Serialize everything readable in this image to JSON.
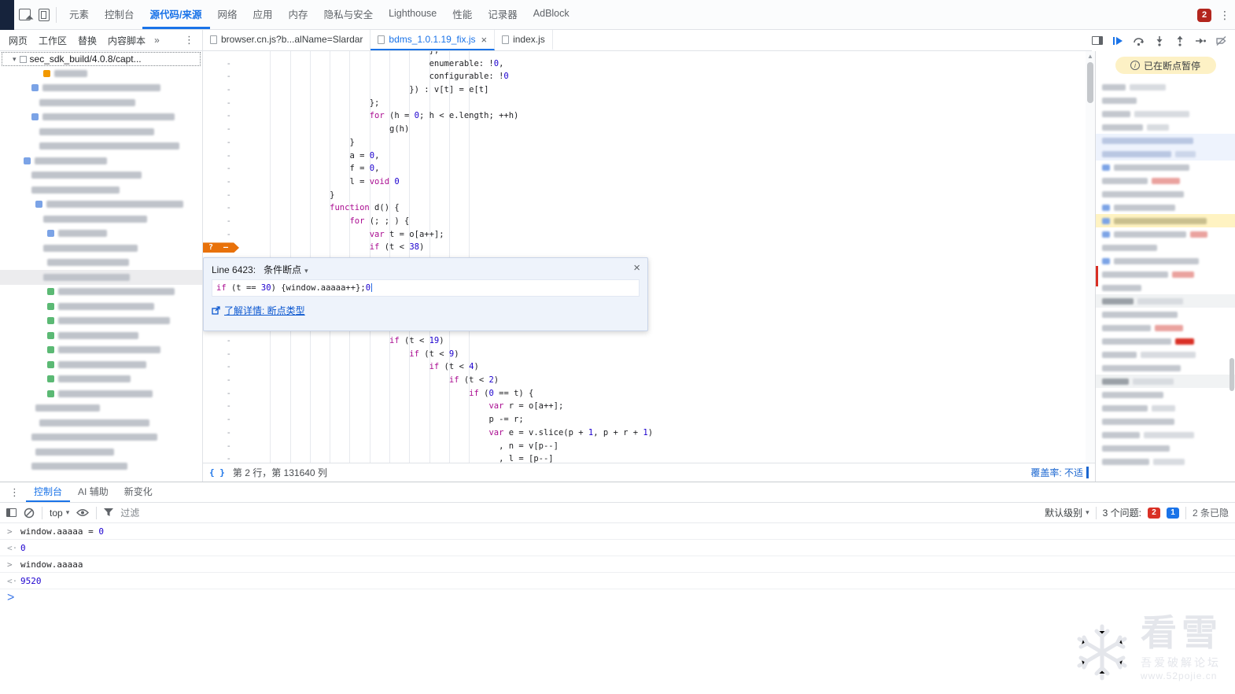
{
  "topbar": {
    "tabs": [
      {
        "label": "元素",
        "active": false
      },
      {
        "label": "控制台",
        "active": false
      },
      {
        "label": "源代码/来源",
        "active": true
      },
      {
        "label": "网络",
        "active": false
      },
      {
        "label": "应用",
        "active": false
      },
      {
        "label": "内存",
        "active": false
      },
      {
        "label": "隐私与安全",
        "active": false
      },
      {
        "label": "Lighthouse",
        "active": false
      },
      {
        "label": "性能",
        "active": false
      },
      {
        "label": "记录器",
        "active": false
      },
      {
        "label": "AdBlock",
        "active": false
      }
    ],
    "error_count": "2"
  },
  "sources": {
    "sidebar_tabs": [
      "网页",
      "工作区",
      "替换",
      "内容脚本"
    ],
    "overflow_label": "»",
    "tree_root": "sec_sdk_build/4.0.8/capt...",
    "file_tabs": [
      {
        "label": "browser.cn.js?b...alName=Slardar",
        "active": false,
        "closable": false
      },
      {
        "label": "bdms_1.0.1.19_fix.js",
        "active": true,
        "closable": true
      },
      {
        "label": "index.js",
        "active": false,
        "closable": false
      }
    ],
    "paused_banner": "已在断点暂停"
  },
  "editor": {
    "gutter_char": "-",
    "bp_marker": "?",
    "dialog_after_index": 15,
    "lines": [
      {
        "ind": 36,
        "tk": [
          [
            "p",
            "},"
          ]
        ]
      },
      {
        "ind": 36,
        "tk": [
          [
            "p",
            "enumerable: !"
          ],
          [
            "n",
            "0"
          ],
          [
            "p",
            ","
          ]
        ]
      },
      {
        "ind": 36,
        "tk": [
          [
            "p",
            "configurable: !"
          ],
          [
            "n",
            "0"
          ]
        ]
      },
      {
        "ind": 32,
        "tk": [
          [
            "p",
            "}) : v[t] = e[t]"
          ]
        ]
      },
      {
        "ind": 24,
        "tk": [
          [
            "p",
            "};"
          ]
        ]
      },
      {
        "ind": 24,
        "tk": [
          [
            "k",
            "for"
          ],
          [
            "p",
            " (h = "
          ],
          [
            "n",
            "0"
          ],
          [
            "p",
            "; h < e.length; ++h)"
          ]
        ]
      },
      {
        "ind": 28,
        "tk": [
          [
            "p",
            "g(h)"
          ]
        ]
      },
      {
        "ind": 20,
        "tk": [
          [
            "p",
            "}"
          ]
        ]
      },
      {
        "ind": 20,
        "tk": [
          [
            "p",
            "a = "
          ],
          [
            "n",
            "0"
          ],
          [
            "p",
            ","
          ]
        ]
      },
      {
        "ind": 20,
        "tk": [
          [
            "p",
            "f = "
          ],
          [
            "n",
            "0"
          ],
          [
            "p",
            ","
          ]
        ]
      },
      {
        "ind": 20,
        "tk": [
          [
            "p",
            "l = "
          ],
          [
            "k",
            "void"
          ],
          [
            "p",
            " "
          ],
          [
            "n",
            "0"
          ]
        ]
      },
      {
        "ind": 16,
        "tk": [
          [
            "p",
            "}"
          ]
        ]
      },
      {
        "ind": 16,
        "tk": [
          [
            "k",
            "function"
          ],
          [
            "p",
            " d() {"
          ]
        ]
      },
      {
        "ind": 20,
        "tk": [
          [
            "k",
            "for"
          ],
          [
            "p",
            " (; ; ) {"
          ]
        ]
      },
      {
        "ind": 24,
        "tk": [
          [
            "k",
            "var"
          ],
          [
            "p",
            " t = o[a++];"
          ]
        ]
      },
      {
        "ind": 24,
        "tk": [
          [
            "k",
            "if"
          ],
          [
            "p",
            " (t < "
          ],
          [
            "n",
            "38"
          ],
          [
            "p",
            ")"
          ]
        ],
        "bp": true
      },
      {
        "ind": 28,
        "tk": [
          [
            "k",
            "if"
          ],
          [
            "p",
            " (t < "
          ],
          [
            "n",
            "19"
          ],
          [
            "p",
            ")"
          ]
        ]
      },
      {
        "ind": 32,
        "tk": [
          [
            "k",
            "if"
          ],
          [
            "p",
            " (t < "
          ],
          [
            "n",
            "9"
          ],
          [
            "p",
            ")"
          ]
        ]
      },
      {
        "ind": 36,
        "tk": [
          [
            "k",
            "if"
          ],
          [
            "p",
            " (t < "
          ],
          [
            "n",
            "4"
          ],
          [
            "p",
            ")"
          ]
        ]
      },
      {
        "ind": 40,
        "tk": [
          [
            "k",
            "if"
          ],
          [
            "p",
            " (t < "
          ],
          [
            "n",
            "2"
          ],
          [
            "p",
            ")"
          ]
        ]
      },
      {
        "ind": 44,
        "tk": [
          [
            "k",
            "if"
          ],
          [
            "p",
            " ("
          ],
          [
            "n",
            "0"
          ],
          [
            "p",
            " == t) {"
          ]
        ]
      },
      {
        "ind": 48,
        "tk": [
          [
            "k",
            "var"
          ],
          [
            "p",
            " r = o[a++];"
          ]
        ]
      },
      {
        "ind": 48,
        "tk": [
          [
            "p",
            "p -= r;"
          ]
        ]
      },
      {
        "ind": 48,
        "tk": [
          [
            "k",
            "var"
          ],
          [
            "p",
            " e = v.slice(p + "
          ],
          [
            "n",
            "1"
          ],
          [
            "p",
            ", p + r + "
          ],
          [
            "n",
            "1"
          ],
          [
            "p",
            ")"
          ]
        ]
      },
      {
        "ind": 50,
        "tk": [
          [
            "p",
            ", n = v[p--]"
          ]
        ]
      },
      {
        "ind": 50,
        "tk": [
          [
            "p",
            ", l = [p--]"
          ]
        ]
      }
    ],
    "dialog": {
      "line_label": "Line 6423:",
      "type_label": "条件断点",
      "expression_tokens": [
        [
          "k",
          "if"
        ],
        [
          "p",
          " (t == "
        ],
        [
          "n",
          "30"
        ],
        [
          "p",
          ") {window.aaaaa++};"
        ],
        [
          "n",
          "0"
        ]
      ],
      "learn_more": "了解详情: 断点类型"
    },
    "status_line": "第 2 行，第 131640 列",
    "coverage": "覆盖率: 不适"
  },
  "console": {
    "tabs": [
      {
        "label": "控制台",
        "active": true
      },
      {
        "label": "AI 辅助",
        "active": false
      },
      {
        "label": "新变化",
        "active": false
      }
    ],
    "context": "top",
    "filter": "过滤",
    "level": "默认级别",
    "issues_label": "3 个问题:",
    "issue_badges": [
      {
        "count": "2",
        "color": "#d93025"
      },
      {
        "count": "1",
        "color": "#1a73e8"
      }
    ],
    "hidden_label": "2 条已隐",
    "input_marker": ">",
    "result_marker": "<·",
    "prompt_marker": ">",
    "entries": [
      {
        "kind": "input",
        "tokens": [
          [
            "p",
            "window.aaaaa = "
          ],
          [
            "n",
            "0"
          ]
        ]
      },
      {
        "kind": "result",
        "tokens": [
          [
            "n",
            "0"
          ]
        ]
      },
      {
        "kind": "input",
        "tokens": [
          [
            "p",
            "window.aaaaa"
          ]
        ]
      },
      {
        "kind": "result",
        "tokens": [
          [
            "n",
            "9520"
          ]
        ]
      }
    ]
  },
  "watermark": {
    "title": "看雪",
    "line1": "吾爱破解论坛",
    "line2": "www.52pojie.cn"
  }
}
